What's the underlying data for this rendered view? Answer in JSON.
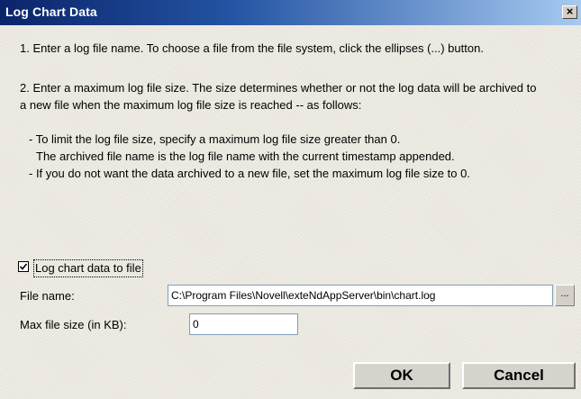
{
  "window": {
    "title": "Log Chart Data",
    "close_glyph": "×"
  },
  "instructions": {
    "step1": "1. Enter a log file name. To choose a file from the file system, click the ellipses (...) button.",
    "step2_line1": "2. Enter a maximum log file size. The size determines whether or not the log data will be archived to",
    "step2_line2": "a new file when the maximum log file size is reached -- as follows:",
    "bullet1_line1": "- To limit the log file size, specify a maximum log file size greater than 0.",
    "bullet1_line2": "The archived file name is the log file name with the current timestamp appended.",
    "bullet2": "- If you do not want the data archived to a new file, set the maximum log file size to 0."
  },
  "log_to_file": {
    "label": "Log chart data to file",
    "checked": true
  },
  "file_name": {
    "label": "File name:",
    "value": "C:\\Program Files\\Novell\\exteNdAppServer\\bin\\chart.log",
    "browse_label": "..."
  },
  "max_size": {
    "label": "Max file size (in KB):",
    "value": "0"
  },
  "buttons": {
    "ok": "OK",
    "cancel": "Cancel"
  }
}
